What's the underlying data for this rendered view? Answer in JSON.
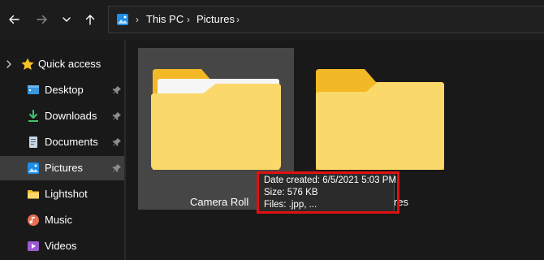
{
  "navigation": {
    "back_icon": "arrow-left-icon",
    "forward_icon": "arrow-right-icon",
    "recent_icon": "chevron-down-icon",
    "up_icon": "arrow-up-icon"
  },
  "address_bar": {
    "location_icon": "pictures-icon",
    "breadcrumbs": [
      {
        "label": "This PC"
      },
      {
        "label": "Pictures"
      }
    ]
  },
  "sidebar": {
    "quick_access_label": "Quick access",
    "items": [
      {
        "label": "Desktop",
        "icon": "desktop-icon",
        "pinned": true
      },
      {
        "label": "Downloads",
        "icon": "download-icon",
        "pinned": true
      },
      {
        "label": "Documents",
        "icon": "document-icon",
        "pinned": true
      },
      {
        "label": "Pictures",
        "icon": "pictures-icon",
        "pinned": true,
        "selected": true
      },
      {
        "label": "Lightshot",
        "icon": "folder-icon",
        "pinned": false
      },
      {
        "label": "Music",
        "icon": "music-icon",
        "pinned": false
      },
      {
        "label": "Videos",
        "icon": "video-icon",
        "pinned": false
      }
    ]
  },
  "content": {
    "folders": [
      {
        "label": "Camera Roll",
        "selected": true
      },
      {
        "label": "res",
        "selected": false
      }
    ]
  },
  "tooltip": {
    "date_created": "Date created: 6/5/2021 5:03 PM",
    "size": "Size: 576 KB",
    "files": "Files: .jpp, ..."
  },
  "colors": {
    "background": "#191919",
    "selection": "#464646",
    "sidebar_selection": "#3d3d3d",
    "highlight_border": "#e01010",
    "folder_front": "#fbd86a",
    "folder_back": "#f2b825"
  }
}
